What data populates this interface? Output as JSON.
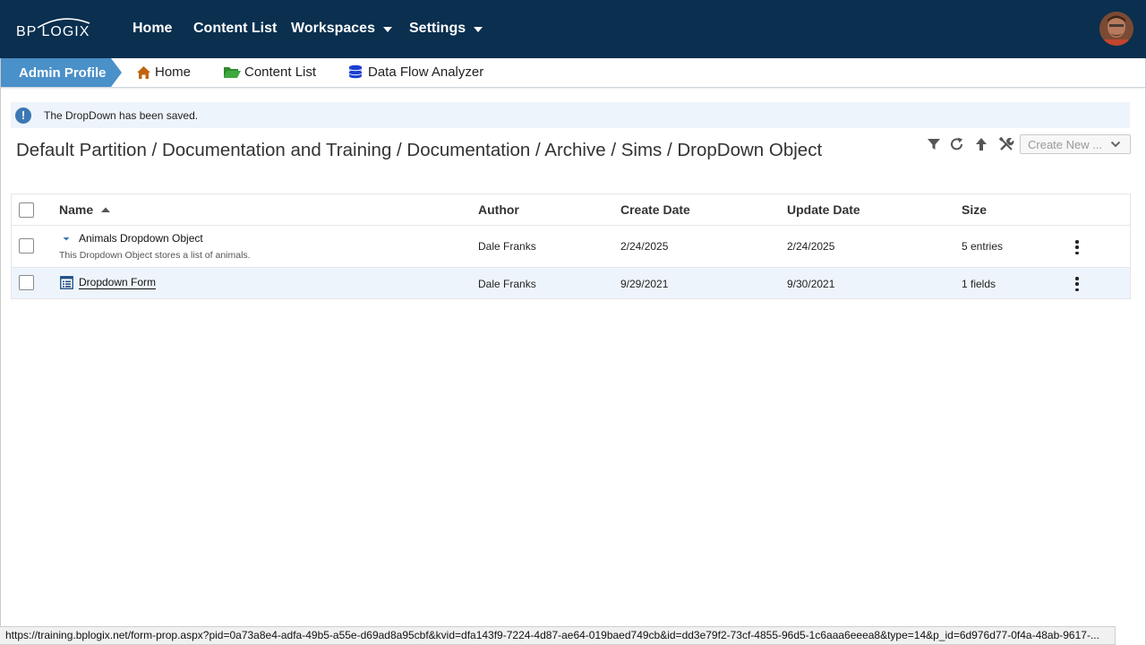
{
  "topnav": {
    "logo_text": "BP LOGIX",
    "items": [
      {
        "label": "Home"
      },
      {
        "label": "Content List"
      },
      {
        "label": "Workspaces"
      },
      {
        "label": "Settings"
      }
    ]
  },
  "breadcrumb": {
    "active": "Admin Profile",
    "links": [
      {
        "label": "Home",
        "icon": "home-icon"
      },
      {
        "label": "Content List",
        "icon": "folder-icon"
      },
      {
        "label": "Data Flow Analyzer",
        "icon": "database-icon"
      }
    ]
  },
  "alert": {
    "icon": "!",
    "message": "The DropDown has been saved."
  },
  "path_title": "Default Partition / Documentation and Training / Documentation / Archive / Sims / DropDown Object",
  "toolbar": {
    "create_new_label": "Create New ..."
  },
  "table": {
    "headers": {
      "name": "Name",
      "author": "Author",
      "create_date": "Create Date",
      "update_date": "Update Date",
      "size": "Size"
    },
    "rows": [
      {
        "name": "Animals Dropdown Object",
        "description": "This Dropdown Object stores a list of animals.",
        "author": "Dale Franks",
        "create_date": "2/24/2025",
        "update_date": "2/24/2025",
        "size": "5 entries"
      },
      {
        "name": "Dropdown Form",
        "author": "Dale Franks",
        "create_date": "9/29/2021",
        "update_date": "9/30/2021",
        "size": "1 fields"
      }
    ]
  },
  "status_bar": {
    "url": "https://training.bplogix.net/form-prop.aspx?pid=0a73a8e4-adfa-49b5-a55e-d69ad8a95cbf&kvid=dfa143f9-7224-4d87-ae64-019baed749cb&id=dd3e79f2-73cf-4855-96d5-1c6aaa6eeea8&type=14&p_id=6d976d77-0f4a-48ab-9617-..."
  },
  "colors": {
    "nav_bg": "#0a2f4f",
    "crumb_active_bg": "#4a90c9",
    "alert_bg": "#eef4fb",
    "alert_icon": "#3c78b5",
    "home_icon": "#c0640f",
    "folder_icon": "#2e8b2e",
    "database_icon": "#1a3fd1"
  }
}
